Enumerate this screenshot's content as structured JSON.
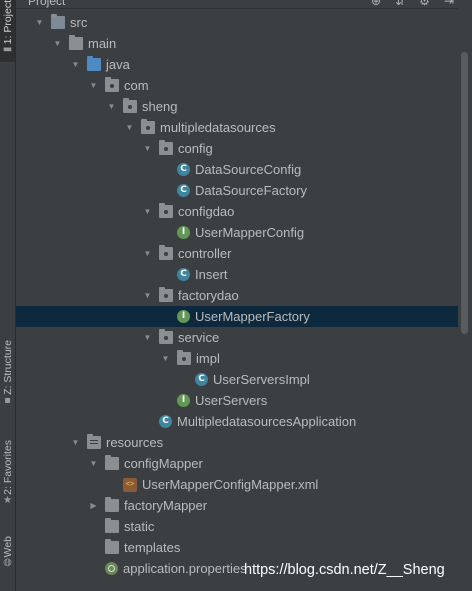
{
  "tool_windows": [
    {
      "label": "1: Project",
      "icon": "folder-icon"
    },
    {
      "label": "Z: Structure",
      "icon": "structure-icon"
    },
    {
      "label": "2: Favorites",
      "icon": "star-icon"
    },
    {
      "label": "Web",
      "icon": "globe-icon"
    }
  ],
  "header": {
    "title": "Project"
  },
  "tree": [
    {
      "label": "src",
      "icon": "source-folder-icon",
      "expanded": true
    },
    {
      "label": "main",
      "icon": "folder-icon",
      "expanded": true
    },
    {
      "label": "java",
      "icon": "java-source-folder-icon",
      "expanded": true
    },
    {
      "label": "com",
      "icon": "package-icon",
      "expanded": true
    },
    {
      "label": "sheng",
      "icon": "package-icon",
      "expanded": true
    },
    {
      "label": "multipledatasources",
      "icon": "package-icon",
      "expanded": true
    },
    {
      "label": "config",
      "icon": "package-icon",
      "expanded": true
    },
    {
      "label": "DataSourceConfig",
      "icon": "class-icon",
      "glyph": "C"
    },
    {
      "label": "DataSourceFactory",
      "icon": "class-icon",
      "glyph": "C"
    },
    {
      "label": "configdao",
      "icon": "package-icon",
      "expanded": true
    },
    {
      "label": "UserMapperConfig",
      "icon": "interface-icon",
      "glyph": "I"
    },
    {
      "label": "controller",
      "icon": "package-icon",
      "expanded": true
    },
    {
      "label": "Insert",
      "icon": "class-icon",
      "glyph": "C"
    },
    {
      "label": "factorydao",
      "icon": "package-icon",
      "expanded": true
    },
    {
      "label": "UserMapperFactory",
      "icon": "interface-icon",
      "glyph": "I",
      "selected": true
    },
    {
      "label": "service",
      "icon": "package-icon",
      "expanded": true
    },
    {
      "label": "impl",
      "icon": "package-icon",
      "expanded": true
    },
    {
      "label": "UserServersImpl",
      "icon": "class-icon",
      "glyph": "C"
    },
    {
      "label": "UserServers",
      "icon": "interface-icon",
      "glyph": "I"
    },
    {
      "label": "MultipledatasourcesApplication",
      "icon": "spring-boot-class-icon",
      "glyph": "C"
    },
    {
      "label": "resources",
      "icon": "resources-folder-icon",
      "expanded": true
    },
    {
      "label": "configMapper",
      "icon": "folder-icon",
      "expanded": true
    },
    {
      "label": "UserMapperConfigMapper.xml",
      "icon": "xml-file-icon",
      "glyph": "<>"
    },
    {
      "label": "factoryMapper",
      "icon": "folder-icon",
      "expanded": false
    },
    {
      "label": "static",
      "icon": "folder-icon"
    },
    {
      "label": "templates",
      "icon": "folder-icon"
    },
    {
      "label": "application.properties",
      "icon": "properties-file-icon"
    }
  ],
  "watermark": "https://blog.csdn.net/Z__Sheng",
  "colors": {
    "background": "#3c3f41",
    "selection": "#0d293e",
    "text": "#bbbbbb",
    "class": "#3e86a0",
    "interface": "#629755"
  }
}
